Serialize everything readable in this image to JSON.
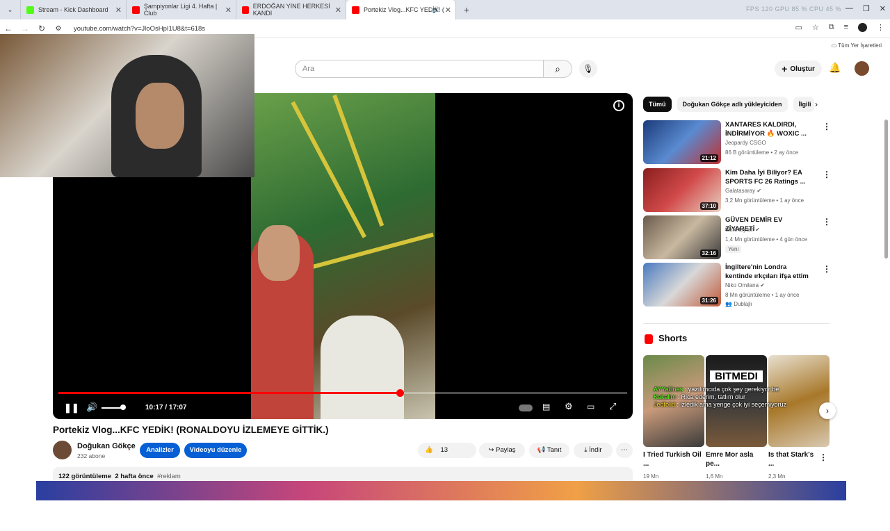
{
  "browser": {
    "tabs": [
      {
        "title": "Stream - Kick Dashboard",
        "color": "#53fc18"
      },
      {
        "title": "Şampiyonlar Ligi 4. Hafta | Club",
        "color": "#ff0000"
      },
      {
        "title": "ERDOĞAN YİNE HERKESİ KANDI",
        "color": "#ff0000"
      },
      {
        "title": "Portekiz Vlog...KFC YEDİK! (",
        "color": "#ff0000"
      }
    ],
    "sysinfo": "FPS 120   GPU 85 %   CPU 45 %",
    "url": "youtube.com/watch?v=JloOsHpI1U8&t=618s",
    "bookmarks_label": "Tüm Yer İşaretleri"
  },
  "header": {
    "search_placeholder": "Ara",
    "create_label": "Oluştur"
  },
  "player": {
    "time": "10:17 / 17:07",
    "progress_fraction": 0.6
  },
  "video": {
    "title": "Portekiz Vlog...KFC YEDİK! (RONALDOYU İZLEMEYE GİTTİK.)",
    "channel": "Doğukan Gökçe",
    "subs": "232 abone",
    "analytics_label": "Analizler",
    "edit_label": "Videoyu düzenle",
    "likes": "13",
    "share_label": "Paylaş",
    "promote_label": "Tanıt",
    "download_label": "İndir",
    "views": "122 görüntüleme",
    "age": "2 hafta önce",
    "tag": "#reklam"
  },
  "chips": [
    "Tümü",
    "Doğukan Gökçe adlı yükleyiciden",
    "İlgili"
  ],
  "recommendations": [
    {
      "title": "XANTARES KALDIRDI, İNDİRMİYOR 🔥 WOXIC ...",
      "channel": "Jeopardy CSGO",
      "meta": "86 B görüntüleme • 2 ay önce",
      "badge": "",
      "duration": "21:12",
      "verified": false
    },
    {
      "title": "Kim Daha İyi Biliyor? EA SPORTS FC 26 Ratings ...",
      "channel": "Galatasaray",
      "meta": "3,2 Mn görüntüleme • 1 ay önce",
      "badge": "",
      "duration": "37:10",
      "verified": true
    },
    {
      "title": "GÜVEN DEMİR EV ZİYARETİ",
      "channel": "testo taylan",
      "meta": "1,4 Mn görüntüleme • 4 gün önce",
      "badge": "Yeni",
      "duration": "32:16",
      "verified": true
    },
    {
      "title": "İngiltere'nin Londra kentinde ırkçıları ifşa ettim",
      "channel": "Niko Omilana",
      "meta": "8 Mn görüntüleme • 1 ay önce",
      "badge": "Dublajlı",
      "duration": "31:26",
      "verified": true
    }
  ],
  "shorts": {
    "heading": "Shorts",
    "items": [
      {
        "title": "I Tried Turkish Oil ...",
        "views": "19 Mn"
      },
      {
        "title": "Emre Mor asla pe...",
        "views": "1,6 Mn"
      },
      {
        "title": "Is that Stark's ...",
        "views": "2,3 Mn"
      }
    ]
  },
  "chat": [
    {
      "user": "AYYaEnes",
      "msg": "yazılımcıda çok şey gerekiyor be"
    },
    {
      "user": "Kakalim",
      "msg": "Rica ederim, tatlım olur"
    },
    {
      "user": "Jedfolid",
      "msg": "izledik ama yenge çok iyi seçemiyoruz"
    }
  ]
}
